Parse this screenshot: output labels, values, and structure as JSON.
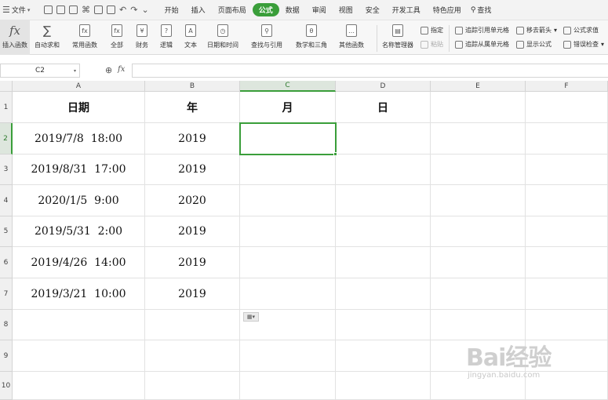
{
  "menubar": {
    "file_label": "文件",
    "tabs": [
      "开始",
      "插入",
      "页面布局",
      "公式",
      "数据",
      "审阅",
      "视图",
      "安全",
      "开发工具",
      "特色应用"
    ],
    "active_tab": "公式",
    "search_label": "查找"
  },
  "ribbon": {
    "insert_function": "插入函数",
    "autosum": "自动求和",
    "common_functions": "常用函数",
    "all": "全部",
    "finance": "财务",
    "logic": "逻辑",
    "text": "文本",
    "datetime": "日期和时间",
    "lookup": "查找与引用",
    "math": "数学和三角",
    "other_functions": "其他函数",
    "name_manager": "名称管理器",
    "specify": "指定",
    "paste": "粘贴",
    "trace_precedents": "追踪引用单元格",
    "trace_dependents": "追踪从属单元格",
    "remove_arrows": "移去箭头",
    "show_formulas": "显示公式",
    "evaluate_formula": "公式求值",
    "error_checking": "错误检查"
  },
  "formula_bar": {
    "name_box": "C2",
    "fx": "fx",
    "formula": ""
  },
  "columns": [
    "A",
    "B",
    "C",
    "D",
    "E",
    "F"
  ],
  "rows": [
    "1",
    "2",
    "3",
    "4",
    "5",
    "6",
    "7",
    "8",
    "9",
    "10"
  ],
  "cells": {
    "A1": "日期",
    "B1": "年",
    "C1": "月",
    "D1": "日",
    "A2": "2019/7/8  18:00",
    "B2": "2019",
    "A3": "2019/8/31  17:00",
    "B3": "2019",
    "A4": "2020/1/5  9:00",
    "B4": "2020",
    "A5": "2019/5/31  2:00",
    "B5": "2019",
    "A6": "2019/4/26  14:00",
    "B6": "2019",
    "A7": "2019/3/21  10:00",
    "B7": "2019"
  },
  "selected_cell": "C2",
  "watermark": {
    "logo": "Bai经验",
    "sub": "jingyan.baidu.com"
  },
  "colors": {
    "accent": "#3a9e3a",
    "header_bg": "#f0f0f0",
    "grid_line": "#e2e2e2"
  }
}
